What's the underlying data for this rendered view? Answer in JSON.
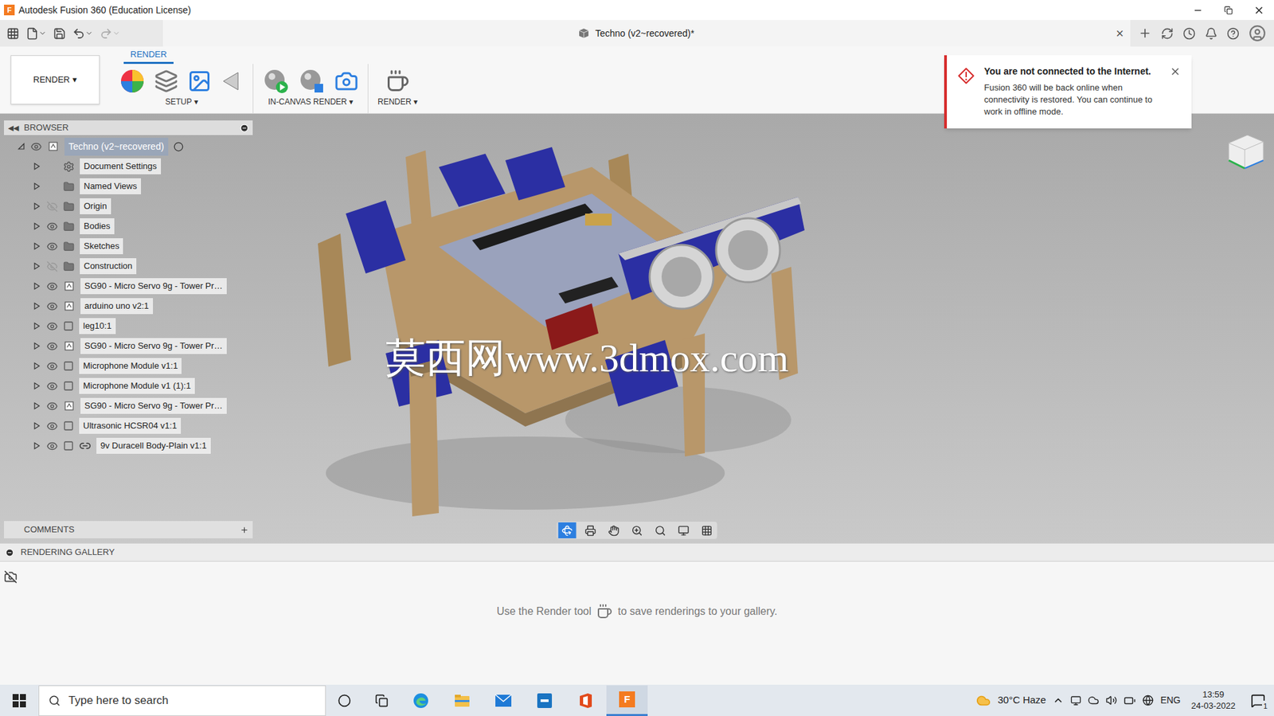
{
  "window": {
    "title": "Autodesk Fusion 360 (Education License)",
    "app_icon_letter": "F"
  },
  "document_tab": {
    "title": "Techno (v2~recovered)*",
    "close": "×"
  },
  "workspace": {
    "label": "RENDER",
    "caret": "▾"
  },
  "ribbon_tabs": [
    {
      "label": "RENDER",
      "selected": true
    }
  ],
  "ribbon_groups": [
    {
      "label": "SETUP",
      "caret": "▾"
    },
    {
      "label": "IN-CANVAS RENDER",
      "caret": "▾"
    },
    {
      "label": "RENDER",
      "caret": "▾"
    }
  ],
  "browser": {
    "title": "BROWSER",
    "root": {
      "label": "Techno (v2~recovered)",
      "expanded": true,
      "selected": true
    },
    "items": [
      {
        "label": "Document Settings",
        "kind": "settings",
        "toggle": false,
        "visible": true,
        "expanded": false
      },
      {
        "label": "Named Views",
        "kind": "folder",
        "toggle": false,
        "visible": true,
        "expanded": false
      },
      {
        "label": "Origin",
        "kind": "folder",
        "toggle": true,
        "visible": false,
        "expanded": false
      },
      {
        "label": "Bodies",
        "kind": "folder",
        "toggle": true,
        "visible": true,
        "expanded": false
      },
      {
        "label": "Sketches",
        "kind": "folder",
        "toggle": true,
        "visible": true,
        "expanded": false
      },
      {
        "label": "Construction",
        "kind": "folder",
        "toggle": true,
        "visible": false,
        "expanded": false
      },
      {
        "label": "SG90 - Micro Servo 9g - Tower Pr…",
        "kind": "component",
        "toggle": true,
        "visible": true,
        "expanded": false
      },
      {
        "label": "arduino uno v2:1",
        "kind": "component",
        "toggle": true,
        "visible": true,
        "expanded": false
      },
      {
        "label": "leg10:1",
        "kind": "occurrence",
        "toggle": true,
        "visible": true,
        "expanded": false
      },
      {
        "label": "SG90 - Micro Servo 9g - Tower Pr…",
        "kind": "component",
        "toggle": true,
        "visible": true,
        "expanded": false
      },
      {
        "label": "Microphone Module v1:1",
        "kind": "occurrence",
        "toggle": true,
        "visible": true,
        "expanded": false
      },
      {
        "label": "Microphone Module v1 (1):1",
        "kind": "occurrence",
        "toggle": true,
        "visible": true,
        "expanded": false
      },
      {
        "label": "SG90 - Micro Servo 9g - Tower Pr…",
        "kind": "component",
        "toggle": true,
        "visible": true,
        "expanded": false
      },
      {
        "label": "Ultrasonic HCSR04 v1:1",
        "kind": "occurrence",
        "toggle": true,
        "visible": true,
        "expanded": false
      },
      {
        "label": "9v Duracell Body-Plain v1:1",
        "kind": "linked",
        "toggle": true,
        "visible": true,
        "expanded": false
      }
    ]
  },
  "comments": {
    "title": "COMMENTS"
  },
  "rendering_gallery": {
    "title": "RENDERING GALLERY",
    "hint_before": "Use the Render tool",
    "hint_after": "to save renderings to your gallery."
  },
  "notification": {
    "title": "You are not connected to the Internet.",
    "body": "Fusion 360 will be back online when connectivity is restored. You can continue to work in offline mode."
  },
  "watermark": "莫西网www.3dmox.com",
  "nav_tools": [
    {
      "kind": "orbit",
      "selected": true
    },
    {
      "kind": "look",
      "selected": false
    },
    {
      "kind": "pan",
      "selected": false
    },
    {
      "kind": "zoom",
      "selected": false
    },
    {
      "kind": "fit",
      "selected": false
    },
    {
      "kind": "display",
      "selected": false
    },
    {
      "kind": "grid",
      "selected": false
    }
  ],
  "taskbar": {
    "search_placeholder": "Type here to search",
    "weather": "30°C Haze",
    "language": "ENG",
    "time": "13:59",
    "date": "24-03-2022",
    "notifications": "1",
    "apps": [
      {
        "kind": "edge",
        "active": false
      },
      {
        "kind": "explorer",
        "active": false
      },
      {
        "kind": "mail",
        "active": false
      },
      {
        "kind": "dell",
        "active": false
      },
      {
        "kind": "office",
        "active": false
      },
      {
        "kind": "fusion",
        "active": true
      }
    ]
  }
}
